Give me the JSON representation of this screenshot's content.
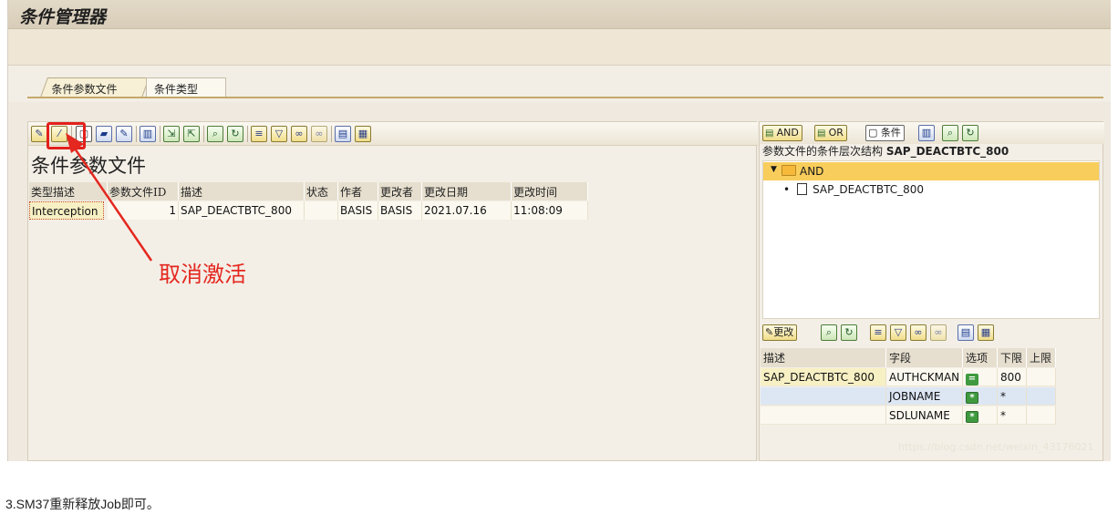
{
  "window": {
    "title": "条件管理器"
  },
  "tabs": [
    {
      "label": "条件参数文件",
      "active": true
    },
    {
      "label": "条件类型",
      "active": false
    }
  ],
  "left_panel": {
    "title": "条件参数文件",
    "table": {
      "headers": [
        "类型描述",
        "参数文件ID",
        "描述",
        "状态",
        "作者",
        "更改者",
        "更改日期",
        "更改时间"
      ],
      "rows": [
        [
          "Interception",
          "1",
          "SAP_DEACTBTC_800",
          "",
          "BASIS",
          "BASIS",
          "2021.07.16",
          "11:08:09"
        ]
      ]
    }
  },
  "annotation": {
    "text": "取消激活",
    "color": "#e4271f"
  },
  "right_panel": {
    "toolbar": {
      "and_label": "AND",
      "or_label": "OR",
      "condition_label": "条件"
    },
    "tree_header_prefix": "参数文件的条件层次结构",
    "tree_header_profile": "SAP_DEACTBTC_800",
    "tree": {
      "root": "AND",
      "children": [
        "SAP_DEACTBTC_800"
      ]
    },
    "param_toolbar": {
      "change_label": "更改"
    },
    "param_table": {
      "headers": [
        "描述",
        "字段",
        "选项",
        "下限",
        "上限"
      ],
      "rows": [
        [
          "SAP_DEACTBTC_800",
          "AUTHCKMAN",
          "=",
          "800",
          ""
        ],
        [
          "",
          "JOBNAME",
          "*",
          "*",
          ""
        ],
        [
          "",
          "SDLUNAME",
          "*",
          "*",
          ""
        ]
      ]
    }
  },
  "watermark": "https://blog.csdn.net/weixin_43176021",
  "footer_text": "3.SM37重新释放Job即可。"
}
